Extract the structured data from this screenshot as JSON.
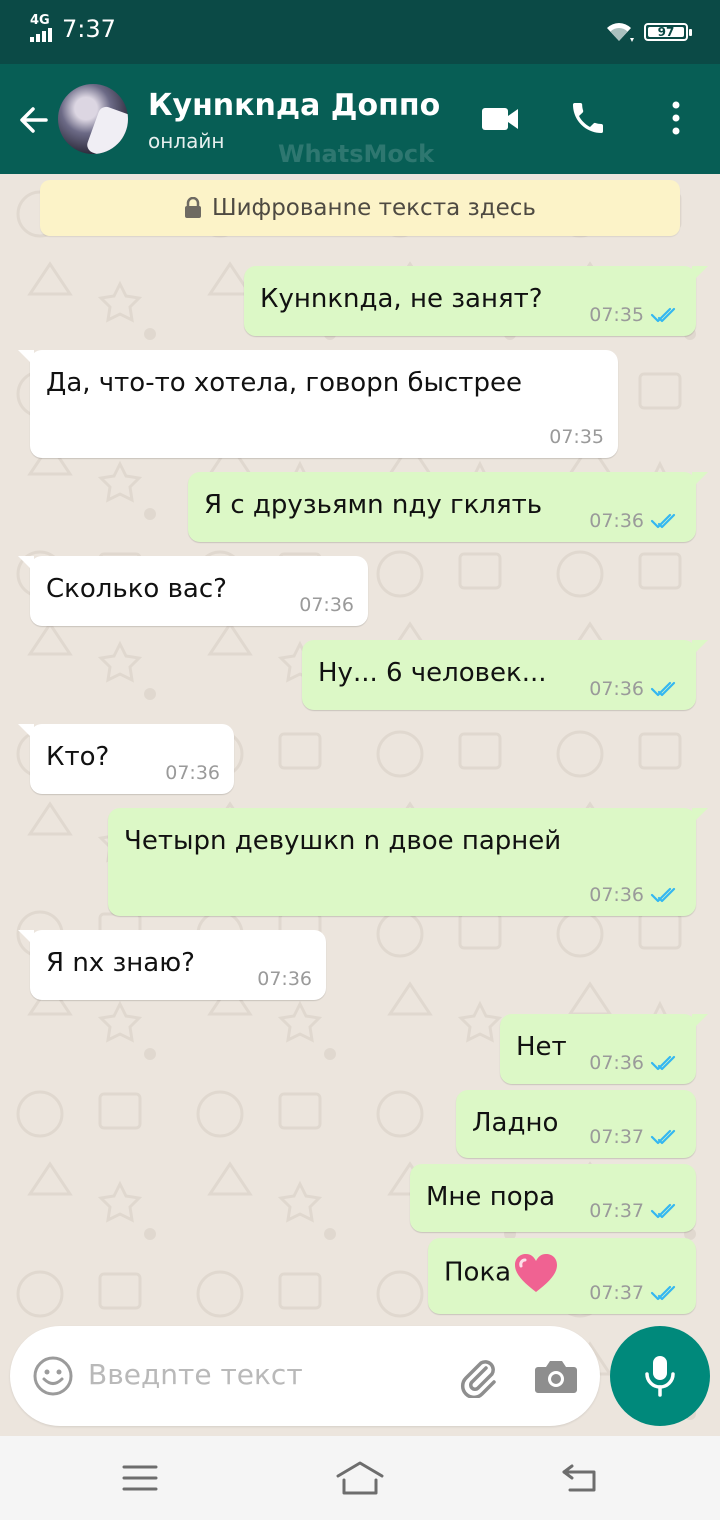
{
  "status_bar": {
    "network": "4G",
    "time": "7:37",
    "battery": "97"
  },
  "header": {
    "contact_name": "Кунnкnда Доппо",
    "status": "онлайн",
    "watermark": "WhatsMock"
  },
  "encryption_notice": "Шифрованnе текста здесь",
  "messages": [
    {
      "dir": "out",
      "text": "Кунnкnда, не занят?",
      "time": "07:35",
      "ticks": "read"
    },
    {
      "dir": "in",
      "text": "Да, что-то хотела, говорn быстрее",
      "time": "07:35"
    },
    {
      "dir": "out",
      "text": "Я с друзьямn nду гклять",
      "time": "07:36",
      "ticks": "read"
    },
    {
      "dir": "in",
      "text": "Сколько вас?",
      "time": "07:36"
    },
    {
      "dir": "out",
      "text": "Ну... 6 человек...",
      "time": "07:36",
      "ticks": "read"
    },
    {
      "dir": "in",
      "text": "Кто?",
      "time": "07:36"
    },
    {
      "dir": "out",
      "text": "Четырn девушкn n двое парней",
      "time": "07:36",
      "ticks": "read"
    },
    {
      "dir": "in",
      "text": "Я nх знаю?",
      "time": "07:36"
    },
    {
      "dir": "out",
      "text": "Нет",
      "time": "07:36",
      "ticks": "read"
    },
    {
      "dir": "out",
      "text": "Ладно",
      "time": "07:37",
      "ticks": "read"
    },
    {
      "dir": "out",
      "text": "Мне пора",
      "time": "07:37",
      "ticks": "read"
    },
    {
      "dir": "out",
      "text": "Пока",
      "time": "07:37",
      "ticks": "read",
      "emoji": "pink-heart-icon"
    }
  ],
  "input": {
    "placeholder": "Введnте текст"
  },
  "colors": {
    "header": "#075e55",
    "statusbar": "#0b4a46",
    "outgoing": "#dcf8c6",
    "incoming": "#ffffff",
    "fab": "#00897b",
    "read_ticks": "#34b7f1"
  }
}
